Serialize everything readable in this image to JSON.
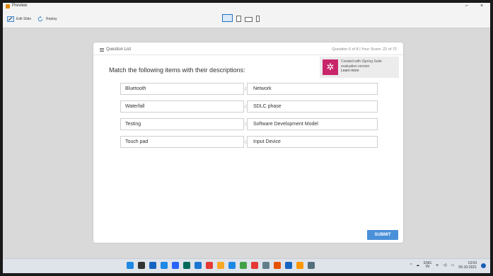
{
  "window": {
    "title": "Preview",
    "min": "⌐",
    "close": "×"
  },
  "toolbar": {
    "edit_slide": "Edit Slide",
    "replay": "Replay",
    "device_icons": [
      "desktop-icon",
      "tablet-portrait-icon",
      "tablet-landscape-icon",
      "phone-icon"
    ]
  },
  "quiz": {
    "question_list": "Question List",
    "progress": "Question 6 of 8",
    "score": "Your Score: 22 of 72",
    "instruction": "Match the following items with their descriptions:",
    "promo": {
      "line1": "Created with iSpring Suite",
      "line2": "evaluation version",
      "learn_more": "Learn more"
    },
    "pairs": [
      {
        "left": "Bluetooth",
        "right": "Network"
      },
      {
        "left": "Waterfall",
        "right": "SDLC phase"
      },
      {
        "left": "Testing",
        "right": "Software Development Model"
      },
      {
        "left": "Touch pad",
        "right": "Input Device"
      }
    ],
    "submit": "SUBMIT"
  },
  "taskbar": {
    "lang_top": "ENG",
    "lang_bottom": "IN",
    "time": "13:03",
    "date": "05-10-2021",
    "icon_colors": [
      "#1e88e5",
      "#333333",
      "#1565c0",
      "#1e88e5",
      "#2962ff",
      "#00695c",
      "#1976d2",
      "#e53935",
      "#f9a825",
      "#1e88e5",
      "#43a047",
      "#e53935",
      "#607d8b",
      "#e65100",
      "#1565c0",
      "#ff9800",
      "#546e7a"
    ]
  }
}
